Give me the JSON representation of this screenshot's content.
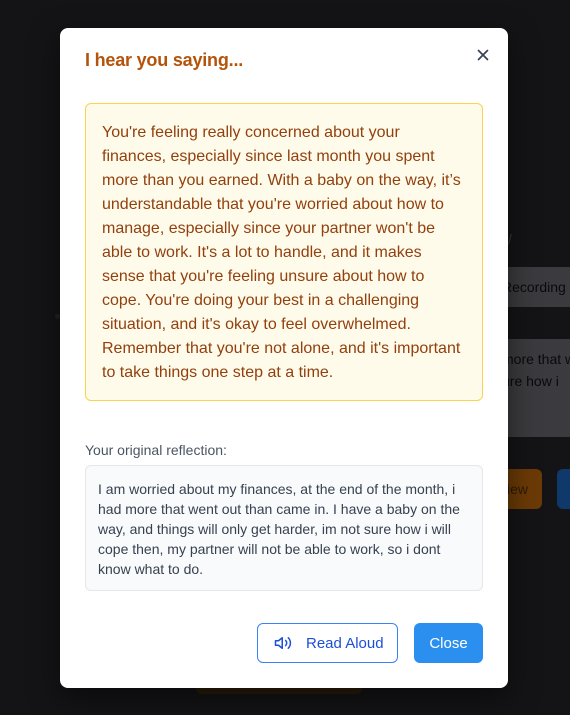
{
  "background": {
    "recording_label": "Recording",
    "textbox_lines": [
      "more that w",
      "ure how i"
    ],
    "orange_button_label": "iew"
  },
  "modal": {
    "title": "I hear you saying...",
    "response": "You're feeling really concerned about your finances, especially since last month you spent more than you earned. With a baby on the way, it’s understandable that you're worried about how to manage, especially since your partner won't be able to work. It's a lot to handle, and it makes sense that you're feeling unsure about how to cope. You're doing your best in a challenging situation, and it's okay to feel overwhelmed. Remember that you're not alone, and it's important to take things one step at a time.",
    "original_label": "Your original reflection:",
    "original_text": "I am worried about my finances, at the end of the month, i had more that went out than came in. I have a baby on the way, and things will only get harder, im not sure how i will cope then, my partner will not be able to work, so i dont know what to do.",
    "read_aloud_label": "Read Aloud",
    "close_label": "Close",
    "icons": {
      "close": "close-icon",
      "speaker": "speaker-icon"
    }
  },
  "colors": {
    "title": "#b45309",
    "response_bg": "#fffbeb",
    "response_border": "#fcd34d",
    "response_text": "#92400e",
    "primary": "#2b8ff0",
    "outline_blue": "#3b82f6"
  }
}
